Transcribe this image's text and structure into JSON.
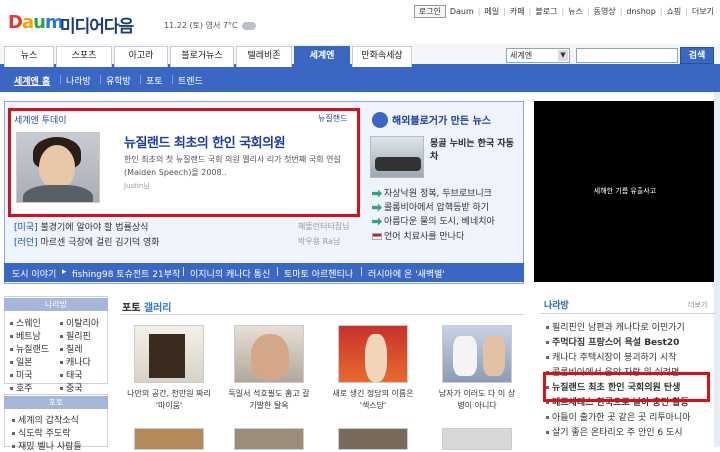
{
  "header": {
    "logo": "Daum",
    "site_name": "미디어다음",
    "date": "11.22 (토)",
    "weather": "영서 7°C",
    "links": [
      "로그인",
      "Daum",
      "메일",
      "카페",
      "블로그",
      "뉴스",
      "동영상",
      "dnshop",
      "쇼핑",
      "더보기"
    ]
  },
  "nav": {
    "tabs": [
      "뉴스",
      "스포츠",
      "아고라",
      "블로거뉴스",
      "텔레비존",
      "세계엔",
      "만화속세상"
    ],
    "active": "세계엔",
    "search_select": "세계엔",
    "search_button": "검색"
  },
  "subnav": {
    "items": [
      "세계엔 홈",
      "나라방",
      "유학방",
      "포토",
      "트렌드"
    ]
  },
  "today": {
    "label": "세계엔 투데이",
    "label_right": "뉴질랜드",
    "headline": "뉴질랜드 최초의 한인 국회의원",
    "desc": "한인 최초의 첫 뉴질랜드 국회 의원 멜리사 리가 첫번째 국회 연설(Maiden Speech)을 2008..",
    "byline": "Justin님",
    "links": [
      {
        "tag": "[미국]",
        "text": "불경기에 알아야 할 법률상식",
        "src": "해뜰런터터집님"
      },
      {
        "tag": "[러던]",
        "text": "마르센 극장에 걸린 김기덕 영화",
        "src": "박우용 Ra님"
      }
    ]
  },
  "blog": {
    "head": "해외블로거가 만든 뉴스",
    "title": "몽골 누비는 한국 자동차",
    "items": [
      "자상낙원 정복, 두브로브니크",
      "콜롬비아에서 압핵등받 하기",
      "아름다운 물의 도시, 베네치아",
      "언어 치료사를 만나다"
    ]
  },
  "story": {
    "label": "도시 이야기",
    "items": [
      "fishing98 토슈전트 21부작",
      "이지니의 캐나다 통신",
      "토마토 아르헨티나",
      "러시아에 온 '새벽별'"
    ]
  },
  "video": {
    "text": "세해한 기름 유출사고"
  },
  "sidebar": {
    "nara_head": "나라방",
    "countries": [
      "스웨인",
      "이탈리아",
      "베트남",
      "필리핀",
      "뉴질랜드",
      "칠레",
      "일본",
      "캐나다",
      "미국",
      "태국",
      "호주",
      "중국"
    ],
    "photo_head": "포토",
    "photo_items": [
      "세계의 갑작소식",
      "식도락 주도락",
      "재밌 벨나 사람들"
    ]
  },
  "gallery": {
    "head_a": "포토",
    "head_b": "갤러리",
    "captions": [
      "나만의 공간, 천만원 짜리 '마이움'",
      "독일서 석호필도 홈고 갈 기발한 탈옥",
      "새로 생긴 정당의 이름은 '섹스당'",
      "남자가 이러도 다 이 상 병이 아니다"
    ]
  },
  "news_right": {
    "head": "나라방",
    "more": "더보기",
    "items": [
      {
        "text": "필리핀인 남편과 캐나다로 이민가기",
        "bold": false
      },
      {
        "text": "주먹다짐 프랑스어 욕설 Best20",
        "bold": true
      },
      {
        "text": "캐나다 주택시장이 붕괴하기 시작",
        "bold": false
      },
      {
        "text": "콜롬비아에서 음악 자랑 위 쉬려면",
        "bold": false
      },
      {
        "text": "뉴질랜드 최초 한인 국회의원 탄생",
        "bold": true
      },
      {
        "text": "메르세데스 한국으로 날아 충전 활동",
        "bold": true
      },
      {
        "text": "아들이 출가한 곳 같은 곳 리투아니아",
        "bold": false
      },
      {
        "text": "살기 좋은 온타리오 주 안인 6 도시",
        "bold": false
      }
    ]
  }
}
